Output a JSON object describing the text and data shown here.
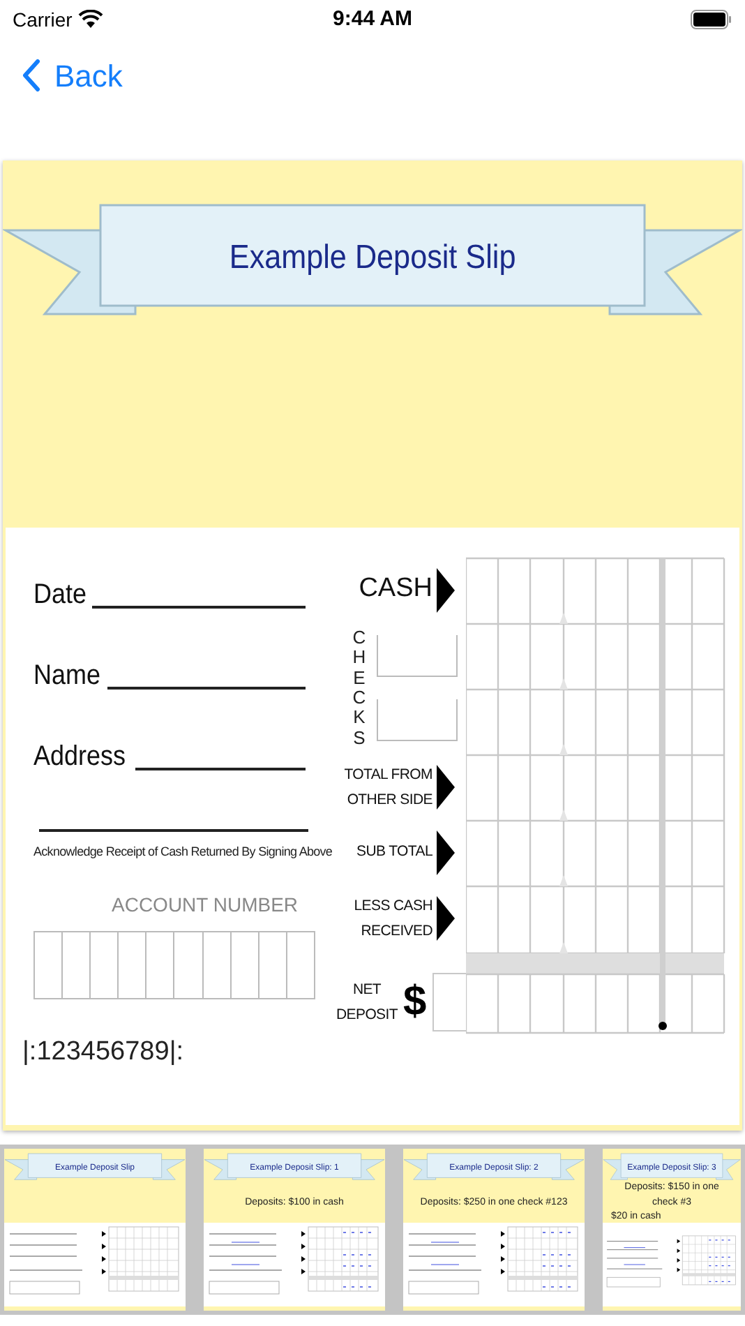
{
  "status_bar": {
    "carrier": "Carrier",
    "time": "9:44 AM"
  },
  "nav": {
    "back_label": "Back"
  },
  "slip": {
    "title": "Example Deposit Slip",
    "fields": [
      {
        "label": "Date"
      },
      {
        "label": "Name"
      },
      {
        "label": "Address"
      }
    ],
    "signature_caption": "Acknowledge Receipt of Cash Returned By Signing Above",
    "account_label": "ACCOUNT NUMBER",
    "routing_number": "|:123456789|:",
    "amount_rows": [
      {
        "kind": "arrow",
        "lines": [
          "CASH"
        ]
      },
      {
        "kind": "vertical",
        "lines": [
          "CHECKS"
        ]
      },
      {
        "kind": "arrow",
        "lines": [
          "TOTAL FROM",
          "OTHER SIDE"
        ]
      },
      {
        "kind": "arrow",
        "lines": [
          "SUB TOTAL"
        ]
      },
      {
        "kind": "arrow",
        "lines": [
          "LESS CASH",
          "RECEIVED"
        ]
      }
    ],
    "net_deposit": {
      "lines": [
        "NET",
        "DEPOSIT"
      ],
      "symbol": "$"
    }
  },
  "thumbnails": [
    {
      "title": "Example Deposit Slip",
      "filled": false
    },
    {
      "title": "Example Deposit Slip: 1",
      "deposits": [
        "Deposits: $100 in cash"
      ],
      "filled": true
    },
    {
      "title": "Example Deposit Slip: 2",
      "deposits": [
        "Deposits: $250 in one check #123"
      ],
      "filled": true
    },
    {
      "title": "Example Deposit Slip: 3",
      "deposits": [
        "Deposits: $150 in one check #3",
        "$20 in cash"
      ],
      "filled": true
    }
  ]
}
